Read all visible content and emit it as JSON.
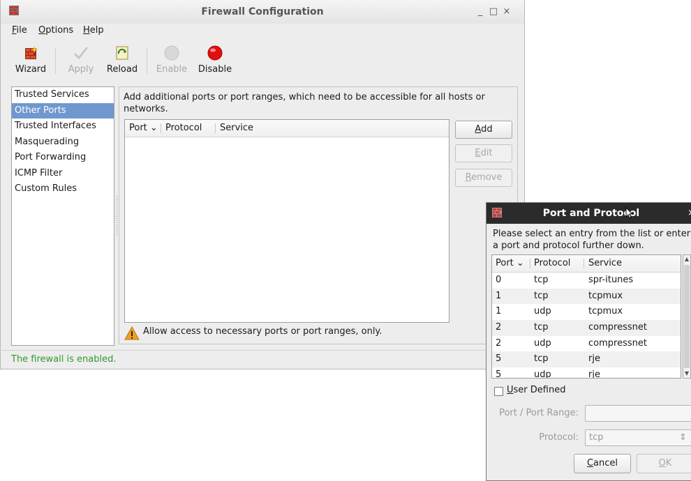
{
  "window": {
    "title": "Firewall Configuration",
    "controls": {
      "minimize": "_",
      "maximize": "□",
      "close": "×"
    }
  },
  "menu": [
    "File",
    "Options",
    "Help"
  ],
  "toolbar": {
    "wizard": "Wizard",
    "apply": "Apply",
    "reload": "Reload",
    "enable": "Enable",
    "disable": "Disable"
  },
  "sidebar": {
    "items": [
      "Trusted Services",
      "Other Ports",
      "Trusted Interfaces",
      "Masquerading",
      "Port Forwarding",
      "ICMP Filter",
      "Custom Rules"
    ],
    "selected": "Other Ports"
  },
  "other_ports": {
    "description": "Add additional ports or port ranges, which need to be accessible for all hosts or networks.",
    "columns": [
      "Port",
      "Protocol",
      "Service"
    ],
    "buttons": {
      "add": "Add",
      "edit": "Edit",
      "remove": "Remove"
    },
    "warning": "Allow access to necessary ports or port ranges, only."
  },
  "status": "The firewall is enabled.",
  "dialog": {
    "title": "Port and Protocol",
    "close": "×",
    "description": "Please select an entry from the list or enter a port and protocol further down.",
    "columns": [
      "Port",
      "Protocol",
      "Service"
    ],
    "rows": [
      [
        "0",
        "tcp",
        "spr-itunes"
      ],
      [
        "1",
        "tcp",
        "tcpmux"
      ],
      [
        "1",
        "udp",
        "tcpmux"
      ],
      [
        "2",
        "tcp",
        "compressnet"
      ],
      [
        "2",
        "udp",
        "compressnet"
      ],
      [
        "5",
        "tcp",
        "rje"
      ],
      [
        "5",
        "udp",
        "rje"
      ]
    ],
    "user_defined": "User Defined",
    "port_range_label": "Port / Port Range:",
    "port_range_value": "",
    "protocol_label": "Protocol:",
    "protocol_value": "tcp",
    "cancel": "Cancel",
    "ok": "OK"
  },
  "colors": {
    "selection": "#6f98cf",
    "status_text": "#2e9a2e",
    "disable_icon": "#e01010",
    "dialog_titlebar": "#2b2b2b"
  }
}
